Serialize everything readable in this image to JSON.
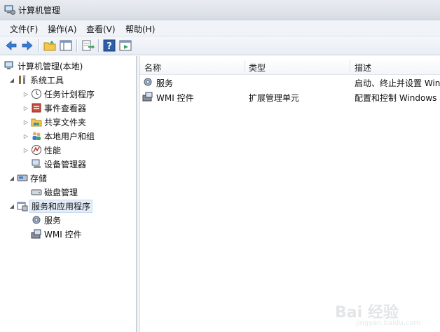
{
  "window": {
    "title": "计算机管理"
  },
  "menu": [
    "文件(F)",
    "操作(A)",
    "查看(V)",
    "帮助(H)"
  ],
  "toolbar": {
    "buttons": [
      "back-arrow-icon",
      "forward-arrow-icon",
      "up-folder-icon",
      "show-hide-tree-icon",
      "export-list-icon",
      "help-icon",
      "properties-icon"
    ]
  },
  "tree": {
    "root": "计算机管理(本地)",
    "system_tools": "系统工具",
    "task_scheduler": "任务计划程序",
    "event_viewer": "事件查看器",
    "shared_folders": "共享文件夹",
    "local_users": "本地用户和组",
    "performance": "性能",
    "device_manager": "设备管理器",
    "storage": "存储",
    "disk_management": "磁盘管理",
    "services_apps": "服务和应用程序",
    "services": "服务",
    "wmi": "WMI 控件"
  },
  "list": {
    "columns": [
      "名称",
      "类型",
      "描述"
    ],
    "rows": [
      {
        "name": "服务",
        "type": "",
        "desc": "启动、终止并设置 Win"
      },
      {
        "name": "WMI 控件",
        "type": "扩展管理单元",
        "desc": "配置和控制 Windows ."
      }
    ]
  },
  "watermark": {
    "text": "Bai 经验",
    "sub": "jingyan.baidu.com"
  },
  "colors": {
    "accent": "#3a7bd5",
    "selection": "#e3ecf7"
  }
}
